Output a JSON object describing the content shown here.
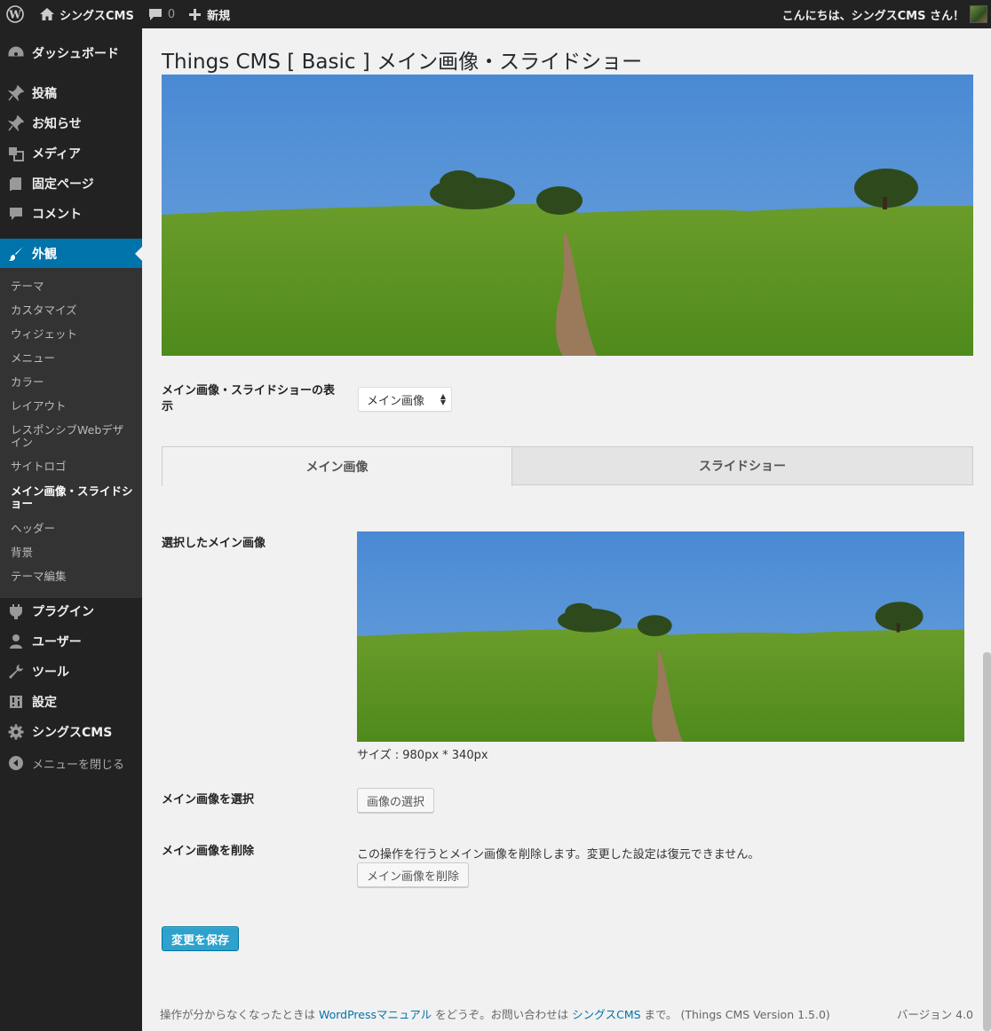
{
  "admin_bar": {
    "site_name": "シングスCMS",
    "comments_count": "0",
    "new_label": "新規",
    "greeting": "こんにちは、シングスCMS さん！",
    "icons": [
      "wordpress-logo-icon",
      "home-icon",
      "comment-bubble-icon",
      "plus-icon"
    ]
  },
  "sidebar": {
    "items": [
      {
        "label": "ダッシュボード",
        "icon": "dashboard-icon"
      },
      {
        "label": "投稿",
        "icon": "pin-icon"
      },
      {
        "label": "お知らせ",
        "icon": "pin-icon"
      },
      {
        "label": "メディア",
        "icon": "media-icon"
      },
      {
        "label": "固定ページ",
        "icon": "page-icon"
      },
      {
        "label": "コメント",
        "icon": "comment-icon"
      },
      {
        "label": "外観",
        "icon": "brush-icon"
      },
      {
        "label": "プラグイン",
        "icon": "plugin-icon"
      },
      {
        "label": "ユーザー",
        "icon": "user-icon"
      },
      {
        "label": "ツール",
        "icon": "wrench-icon"
      },
      {
        "label": "設定",
        "icon": "settings-icon"
      },
      {
        "label": "シングスCMS",
        "icon": "gear-icon"
      }
    ],
    "current": "外観",
    "submenu": [
      "テーマ",
      "カスタマイズ",
      "ウィジェット",
      "メニュー",
      "カラー",
      "レイアウト",
      "レスポンシブWebデザイン",
      "サイトロゴ",
      "メイン画像・スライドショー",
      "ヘッダー",
      "背景",
      "テーマ編集"
    ],
    "submenu_current": "メイン画像・スライドショー",
    "collapse_label": "メニューを閉じる"
  },
  "main": {
    "title": "Things CMS [ Basic ] メイン画像・スライドショー",
    "display_label": "メイン画像・スライドショーの表示",
    "display_select_value": "メイン画像",
    "tabs": [
      {
        "label": "メイン画像",
        "active": true
      },
      {
        "label": "スライドショー",
        "active": false
      }
    ],
    "selected_image_label": "選択したメイン画像",
    "size_text": "サイズ : 980px * 340px",
    "select_image_label": "メイン画像を選択",
    "select_image_button": "画像の選択",
    "delete_image_label": "メイン画像を削除",
    "delete_description": "この操作を行うとメイン画像を削除します。変更した設定は復元できません。",
    "delete_button": "メイン画像を削除",
    "save_button": "変更を保存"
  },
  "footer": {
    "text_before": "操作が分からなくなったときは ",
    "link_manual": "WordPressマニュアル",
    "text_middle": " をどうぞ。お問い合わせは ",
    "link_contact": "シングスCMS",
    "text_after": " まで。 (Things CMS Version 1.5.0)",
    "version": "バージョン 4.0"
  },
  "colors": {
    "admin_bar": "#222222",
    "sidebar": "#222222",
    "submenu": "#333333",
    "current_menu": "#0073aa",
    "primary_button": "#2ea2cc",
    "link": "#0073aa"
  }
}
